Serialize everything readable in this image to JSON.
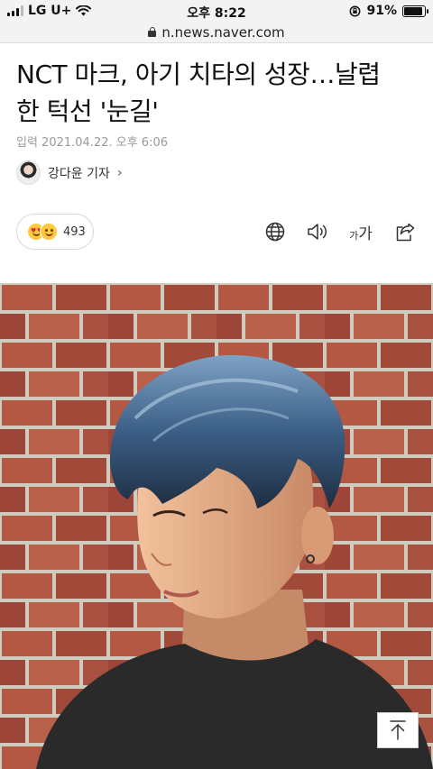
{
  "status_bar": {
    "carrier": "LG U+",
    "time": "오후 8:22",
    "battery_text": "91%",
    "battery_level": 0.91
  },
  "url_bar": {
    "url": "n.news.naver.com"
  },
  "article": {
    "headline_line1": "NCT 마크, 아기 치타의 성장…날렵",
    "headline_line2": "한 턱선 '눈길'",
    "published": "입력 2021.04.22. 오후 6:06",
    "reporter": "강다윤 기자",
    "reporter_chevron": "›",
    "reaction_count": "493",
    "font_size_small": "가",
    "font_size_large": "가"
  },
  "icons": {
    "globe": "globe-icon",
    "speaker": "speaker-icon",
    "font": "font-size-icon",
    "share": "share-icon",
    "top": "arrow-up-icon",
    "lock": "lock-icon",
    "wifi": "wifi-icon"
  },
  "colors": {
    "status_bg": "#f3f3f3",
    "meta_text": "#9a9a9a",
    "hair_blue": "#3b5e86",
    "brick": "#a9503f"
  }
}
